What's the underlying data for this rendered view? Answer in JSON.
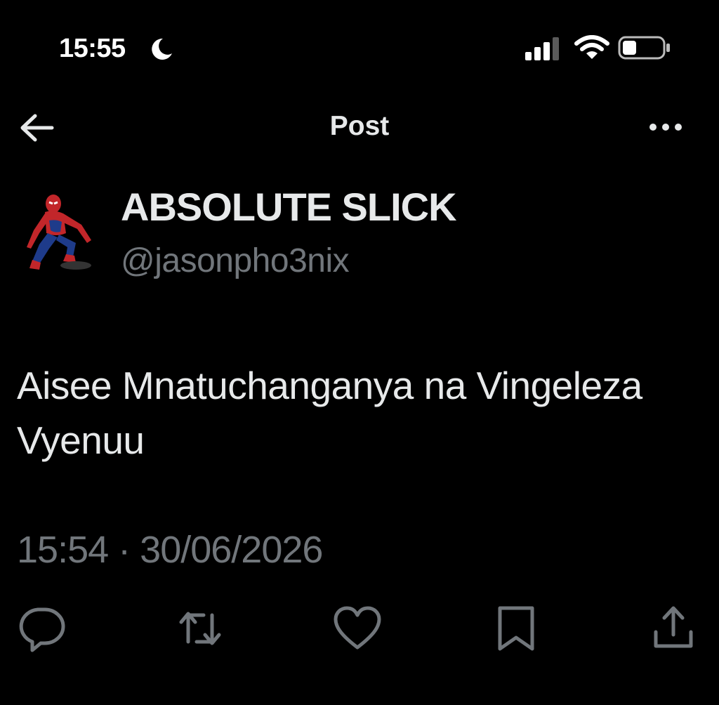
{
  "status": {
    "time": "15:55",
    "icons": [
      "moon-icon",
      "cellular-signal-icon",
      "wifi-icon",
      "battery-icon"
    ]
  },
  "nav": {
    "title": "Post",
    "back_icon": "back-arrow-icon",
    "more_icon": "more-options-icon"
  },
  "author": {
    "display_name": "ABSOLUTE SLICK",
    "handle": "@jasonpho3nix",
    "avatar": "avatar-spiderman"
  },
  "post": {
    "text": "Aisee Mnatuchanganya na Vingeleza Vyenuu",
    "time": "15:54",
    "separator": "·",
    "date": "30/06/2026"
  },
  "actions": [
    {
      "name": "reply",
      "icon": "reply-icon"
    },
    {
      "name": "repost",
      "icon": "repost-icon"
    },
    {
      "name": "like",
      "icon": "like-icon"
    },
    {
      "name": "bookmark",
      "icon": "bookmark-icon"
    },
    {
      "name": "share",
      "icon": "share-icon"
    }
  ],
  "colors": {
    "background": "#000000",
    "text_primary": "#e7e9ea",
    "text_secondary": "#71767b",
    "icon": "#71767b"
  }
}
